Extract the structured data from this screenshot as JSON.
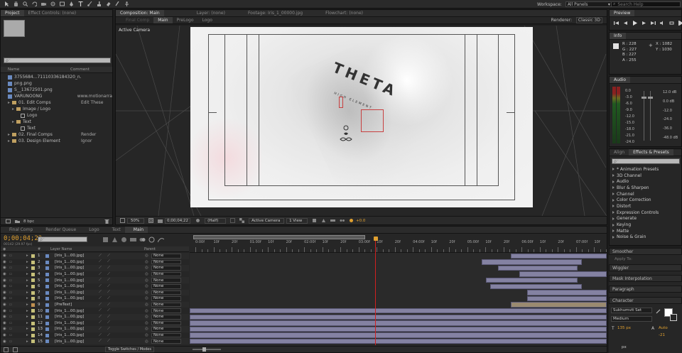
{
  "toolbar": {
    "workspace_label": "Workspace:",
    "workspace_value": "All Panels",
    "search_placeholder": "Search Help"
  },
  "project_panel": {
    "tabs": [
      "Project",
      "Effect Controls: (none)"
    ],
    "search_placeholder": "ρ⁻",
    "columns": [
      "Name",
      "Comment"
    ],
    "items": [
      {
        "name": "3755684...71110336184320_n.png",
        "comment": "",
        "type": "file"
      },
      {
        "name": "png.png",
        "comment": "",
        "type": "file"
      },
      {
        "name": "S__13672501.png",
        "comment": "",
        "type": "file"
      },
      {
        "name": "VARUNOONG",
        "comment": "www.motionarra",
        "type": "file"
      },
      {
        "name": "01. Edit Comps",
        "comment": "Edit These",
        "type": "folder"
      },
      {
        "name": "Image / Logo",
        "comment": "",
        "type": "folder"
      },
      {
        "name": "Logo",
        "comment": "",
        "type": "comp"
      },
      {
        "name": "Text",
        "comment": "",
        "type": "folder"
      },
      {
        "name": "Text",
        "comment": "",
        "type": "comp"
      },
      {
        "name": "02. Final Comps",
        "comment": "Render",
        "type": "folder"
      },
      {
        "name": "03. Design Element",
        "comment": "Ignor",
        "type": "folder"
      }
    ],
    "bpc": "8 bpc"
  },
  "composition_panel": {
    "tabs": [
      "Composition: Main",
      "Layer: (none)",
      "Footage: Iris_1_00000.jpg",
      "Flowchart: (none)"
    ],
    "sub_tabs": [
      "Final Comp",
      "Main",
      "PreLogo",
      "Logo"
    ],
    "renderer_label": "Renderer:",
    "renderer_value": "Classic 3D",
    "active_camera": "Active Camera",
    "zoom": "50%",
    "timecode": "0;00;04;22",
    "resolution": "(Half)",
    "view": "Active Camera",
    "views": "1 View",
    "exposure": "+0.0",
    "image_title": "THETA",
    "image_subtitle": "HIGH ELEMENT"
  },
  "preview_panel": {
    "title": "Preview"
  },
  "info_panel": {
    "title": "Info",
    "r": "R : 228",
    "g": "G : 227",
    "b": "B : 227",
    "a": "A : 255",
    "x": "X : 1082",
    "y": "Y : 1030"
  },
  "audio_panel": {
    "title": "Audio",
    "left_scale": [
      "0.0",
      "-3.0",
      "-6.0",
      "-9.0",
      "-12.0",
      "-15.0",
      "-18.0",
      "-21.0",
      "-24.0"
    ],
    "right_scale": [
      "12.0 dB",
      "0.0 dB",
      "-12.0",
      "-24.0",
      "-36.0",
      "-48.0 dB"
    ]
  },
  "effects_panel": {
    "tabs": [
      "Align",
      "Effects & Presets"
    ],
    "search_placeholder": "ρ⁻",
    "items": [
      "* Animation Presets",
      "3D Channel",
      "Audio",
      "Blur & Sharpen",
      "Channel",
      "Color Correction",
      "Distort",
      "Expression Controls",
      "Generate",
      "Keying",
      "Matte",
      "Noise & Grain"
    ]
  },
  "side_panels": {
    "smoother": "Smoother",
    "apply_to": "Apply To:",
    "wiggler": "Wiggler",
    "mask_interpolation": "Mask Interpolation",
    "paragraph": "Paragraph",
    "character": "Character",
    "font_name": "Sukhumvit Set",
    "font_style": "Medium",
    "font_size": "135 px",
    "tracking": "Auto",
    "kerning": "-21",
    "size_unit": "px"
  },
  "timeline": {
    "tabs": [
      "Final Comp",
      "Render Queue",
      "Logo",
      "Text",
      "Main"
    ],
    "timecode": "0;00;04;22",
    "fps": "00142 (29.97 fps)",
    "search_placeholder": "ρ⁻",
    "col_num": "#",
    "col_name": "Layer Name",
    "col_parent": "Parent",
    "ruler": [
      "0:00f",
      "10f",
      "20f",
      "01:00f",
      "10f",
      "20f",
      "02:00f",
      "10f",
      "20f",
      "03:00f",
      "10f",
      "20f",
      "04:00f",
      "10f",
      "20f",
      "05:00f",
      "10f",
      "20f",
      "06:00f",
      "10f",
      "20f",
      "07:00f",
      "10f"
    ],
    "playhead_frac": 0.445,
    "work_area": [
      0.008,
      0.42
    ],
    "layers": [
      {
        "num": "1",
        "name": "[Iris_1...00.jpg]",
        "parent": "None",
        "start": 0.77,
        "end": 1.0,
        "color": "#8482a2"
      },
      {
        "num": "2",
        "name": "[Iris_1...00.jpg]",
        "parent": "None",
        "start": 0.7,
        "end": 0.94,
        "color": "#8482a2"
      },
      {
        "num": "3",
        "name": "[Iris_1...00.jpg]",
        "parent": "None",
        "start": 0.74,
        "end": 0.93,
        "color": "#8482a2"
      },
      {
        "num": "4",
        "name": "[Iris_1...00.jpg]",
        "parent": "None",
        "start": 0.79,
        "end": 1.0,
        "color": "#8482a2"
      },
      {
        "num": "5",
        "name": "[Iris_1...00.jpg]",
        "parent": "None",
        "start": 0.71,
        "end": 0.93,
        "color": "#8482a2"
      },
      {
        "num": "6",
        "name": "[Iris_1...00.jpg]",
        "parent": "None",
        "start": 0.72,
        "end": 0.94,
        "color": "#8482a2"
      },
      {
        "num": "7",
        "name": "[Iris_1...00.jpg]",
        "parent": "None",
        "start": 0.81,
        "end": 1.0,
        "color": "#8482a2"
      },
      {
        "num": "8",
        "name": "[Iris_1...00.jpg]",
        "parent": "None",
        "start": 0.81,
        "end": 1.0,
        "color": "#8482a2"
      },
      {
        "num": "9",
        "name": "[PreText]",
        "parent": "None",
        "start": 0.77,
        "end": 1.0,
        "color": "#9a8a70"
      },
      {
        "num": "10",
        "name": "[Iris_1...00.jpg]",
        "parent": "None",
        "start": 0.0,
        "end": 1.0,
        "color": "#8482a2"
      },
      {
        "num": "11",
        "name": "[Iris_1...00.jpg]",
        "parent": "None",
        "start": 0.0,
        "end": 1.0,
        "color": "#8482a2"
      },
      {
        "num": "12",
        "name": "[Iris_1...00.jpg]",
        "parent": "None",
        "start": 0.0,
        "end": 1.0,
        "color": "#8482a2"
      },
      {
        "num": "13",
        "name": "[Iris_1...00.jpg]",
        "parent": "None",
        "start": 0.0,
        "end": 1.0,
        "color": "#8482a2"
      },
      {
        "num": "14",
        "name": "[Iris_1...00.jpg]",
        "parent": "None",
        "start": 0.0,
        "end": 1.0,
        "color": "#8482a2"
      },
      {
        "num": "15",
        "name": "[Iris_1...00.jpg]",
        "parent": "None",
        "start": 0.0,
        "end": 1.0,
        "color": "#8482a2"
      }
    ],
    "toggle_label": "Toggle Switches / Modes"
  },
  "colors": {
    "accent": "#f0a030",
    "playhead": "#d02020",
    "bar": "#8482a2",
    "label": "#c6c07a"
  }
}
